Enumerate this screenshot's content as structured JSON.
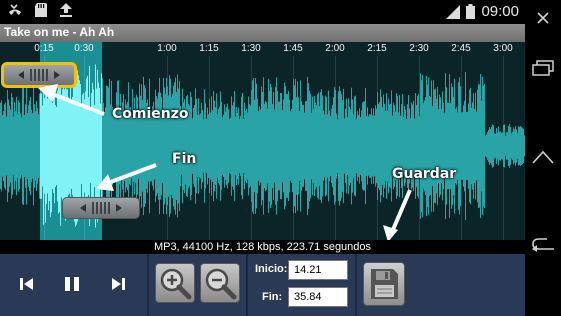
{
  "status_bar": {
    "time": "09:00",
    "icons": [
      "missed-call-icon",
      "sd-card-icon",
      "upload-icon",
      "signal-icon",
      "battery-icon"
    ]
  },
  "title_bar": {
    "title": "Take on me - Ah Ah"
  },
  "timeline": {
    "ticks": [
      "0:15",
      "0:30",
      "1:00",
      "1:15",
      "1:30",
      "1:45",
      "2:00",
      "2:15",
      "2:30",
      "2:45",
      "3:00"
    ]
  },
  "callouts": {
    "start": "Comienzo",
    "end": "Fin",
    "save": "Guardar"
  },
  "info": {
    "text": "MP3, 44100 Hz, 128 kbps, 223.71 segundos"
  },
  "controls": {
    "start_label": "Inicio:",
    "start_value": "14.21",
    "end_label": "Fin:",
    "end_value": "35.84"
  },
  "colors": {
    "waveform": "#2aa3a6",
    "waveform_selected": "#7ff3f6",
    "selection_bg": "#1a8f93",
    "controls_bg": "#2a3a56",
    "start_handle_border": "#f2c200"
  }
}
